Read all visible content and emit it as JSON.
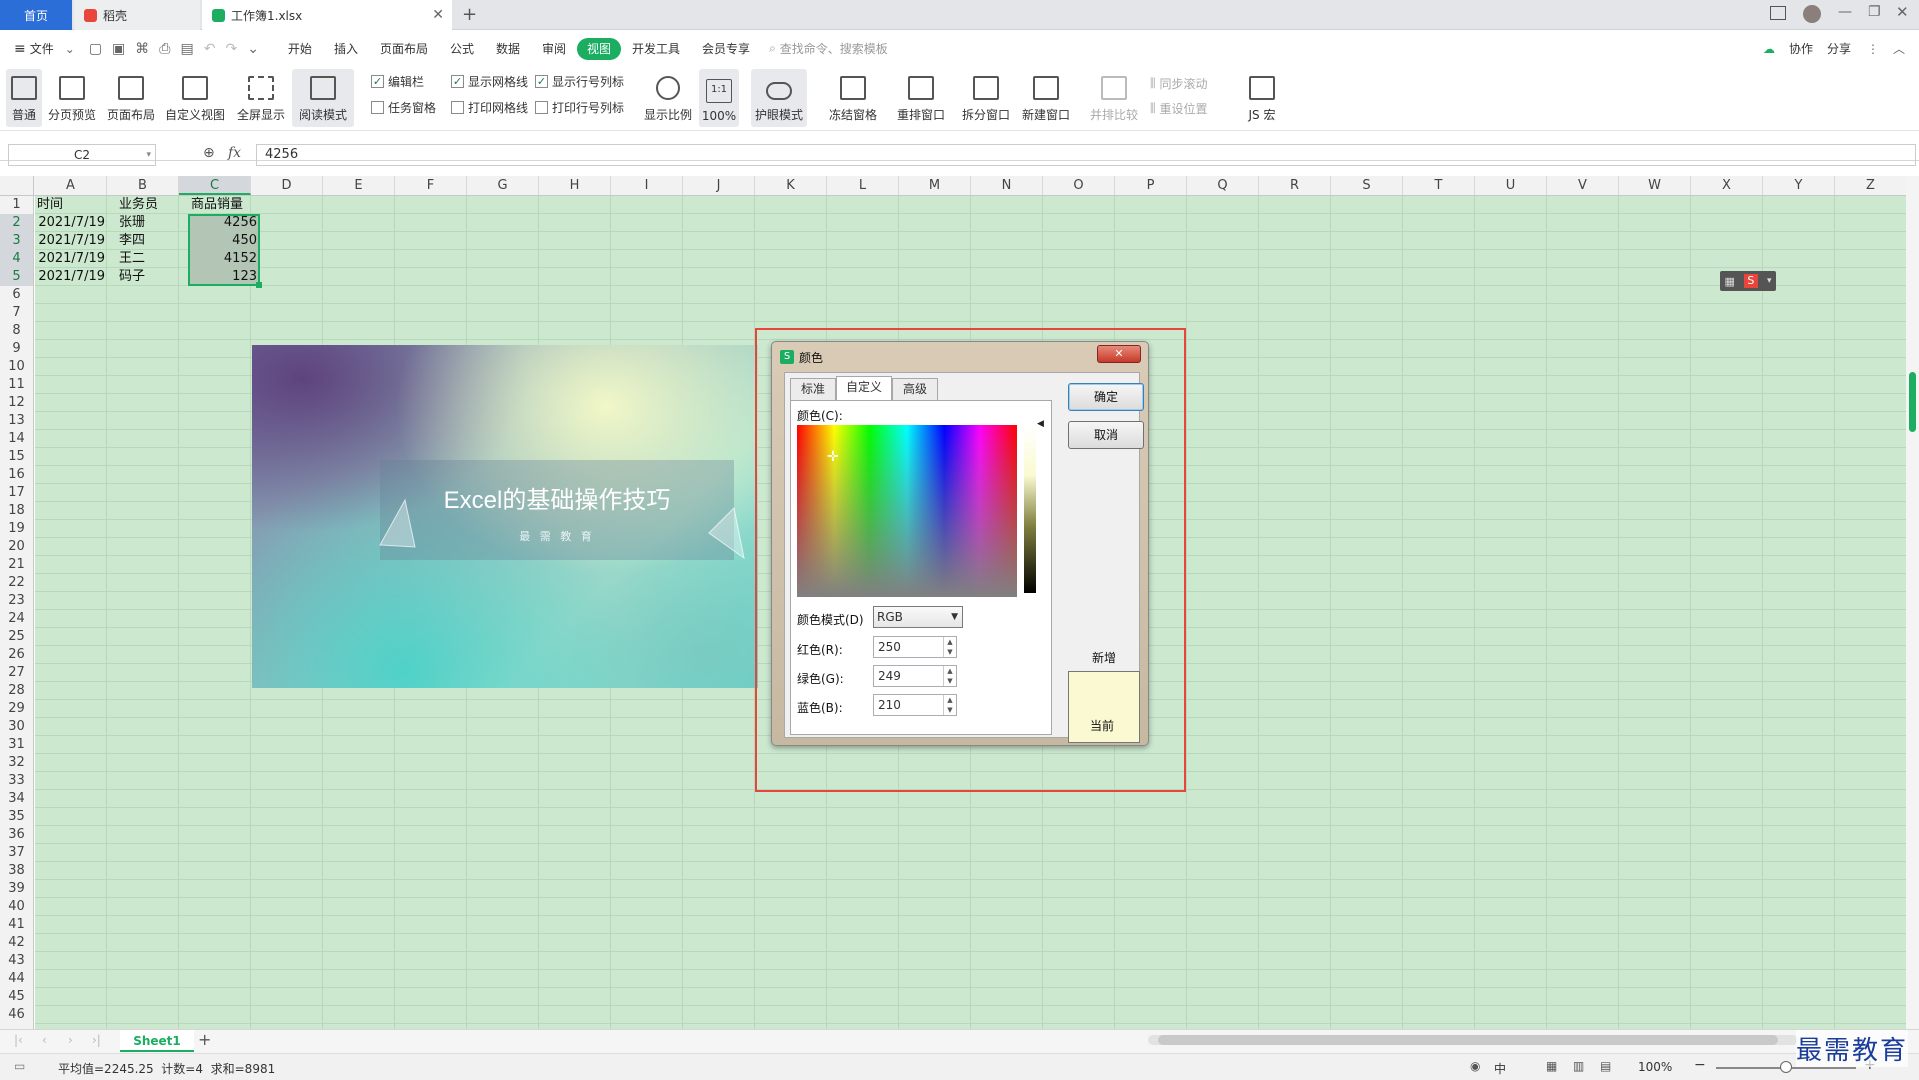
{
  "tabs": {
    "home": "首页",
    "daoke": "稻壳",
    "workbook": "工作簿1.xlsx"
  },
  "menu": {
    "file": "文件",
    "items": [
      "开始",
      "插入",
      "页面布局",
      "公式",
      "数据",
      "审阅",
      "视图",
      "开发工具",
      "会员专享"
    ],
    "search": "查找命令、搜索模板",
    "collab": "协作",
    "share": "分享"
  },
  "ribbon": {
    "buttons": [
      "普通",
      "分页预览",
      "页面布局",
      "自定义视图",
      "全屏显示",
      "阅读模式"
    ],
    "checks": [
      {
        "label": "编辑栏",
        "checked": true
      },
      {
        "label": "显示网格线",
        "checked": true
      },
      {
        "label": "显示行号列标",
        "checked": true
      },
      {
        "label": "任务窗格",
        "checked": false
      },
      {
        "label": "打印网格线",
        "checked": false
      },
      {
        "label": "打印行号列标",
        "checked": false
      }
    ],
    "buttons2": [
      "显示比例",
      "100%",
      "护眼模式",
      "冻结窗格",
      "重排窗口",
      "拆分窗口",
      "新建窗口",
      "并排比较",
      "JS 宏"
    ],
    "sync": "同步滚动",
    "reset": "重设位置",
    "zoom_icon_text": "1:1"
  },
  "formula": {
    "cell": "C2",
    "fx": "fx",
    "value": "4256"
  },
  "columns": [
    "A",
    "B",
    "C",
    "D",
    "E",
    "F",
    "G",
    "H",
    "I",
    "J",
    "K",
    "L",
    "M",
    "N",
    "O",
    "P",
    "Q",
    "R",
    "S",
    "T",
    "U",
    "V",
    "W",
    "X",
    "Y",
    "Z"
  ],
  "rows": [
    "1",
    "2",
    "3",
    "4",
    "5",
    "6",
    "7",
    "8",
    "9",
    "10",
    "11",
    "12",
    "13",
    "14",
    "15",
    "16",
    "17",
    "18",
    "19",
    "20",
    "21",
    "22",
    "23",
    "24",
    "25",
    "26",
    "27",
    "28",
    "29",
    "30",
    "31",
    "32",
    "33",
    "34",
    "35",
    "36",
    "37",
    "38",
    "39",
    "40",
    "41",
    "42",
    "43",
    "44",
    "45",
    "46"
  ],
  "sheet": {
    "headers": [
      "时间",
      "业务员",
      "商品销量"
    ],
    "data": [
      [
        "2021/7/19",
        "张珊",
        "4256"
      ],
      [
        "2021/7/19",
        "李四",
        "450"
      ],
      [
        "2021/7/19",
        "王二",
        "4152"
      ],
      [
        "2021/7/19",
        "码子",
        "123"
      ]
    ]
  },
  "picture": {
    "title": "Excel的基础操作技巧",
    "subtitle": "最 需 教 育"
  },
  "dialog": {
    "title": "颜色",
    "tabs": [
      "标准",
      "自定义",
      "高级"
    ],
    "color_label": "颜色(C):",
    "mode_label": "颜色模式(D)",
    "mode": "RGB",
    "red_label": "红色(R):",
    "green_label": "绿色(G):",
    "blue_label": "蓝色(B):",
    "red": "250",
    "green": "249",
    "blue": "210",
    "ok": "确定",
    "cancel": "取消",
    "new": "新增",
    "current": "当前",
    "swatch": "#faf9d2"
  },
  "sheetbar": {
    "sheet": "Sheet1"
  },
  "status": {
    "summary": "平均值=2245.25  计数=4  求和=8981",
    "zoom": "100%",
    "input": "中"
  },
  "watermark": "最需教育",
  "accent": "#1bae60"
}
